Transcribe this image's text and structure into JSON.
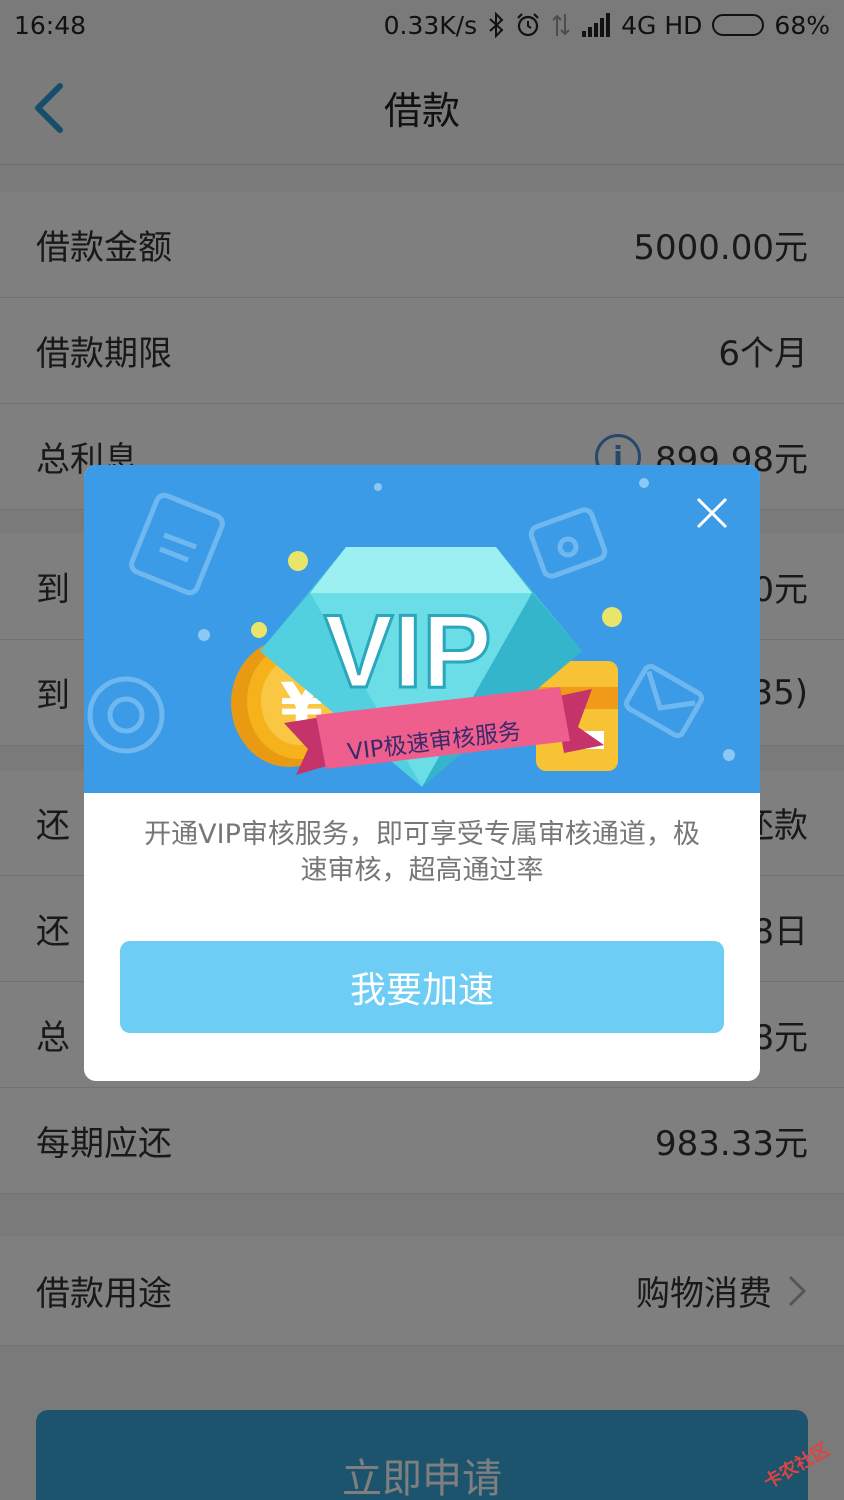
{
  "status_bar": {
    "time": "16:48",
    "network_speed": "0.33K/s",
    "network_type": "4G HD",
    "battery": "68%",
    "battery_level": 0.68,
    "icons": [
      "bluetooth-icon",
      "alarm-icon",
      "data-transfer-icon",
      "signal-icon",
      "battery-icon"
    ]
  },
  "header": {
    "title": "借款",
    "back_icon": "chevron-left-icon"
  },
  "loan": {
    "rows": [
      {
        "label": "借款金额",
        "value": "5000.00元"
      },
      {
        "label": "借款期限",
        "value": "6个月"
      },
      {
        "label": "总利息",
        "value": "899.98元"
      },
      {
        "label": "到",
        "value": "0元"
      },
      {
        "label": "到",
        "value": "35)"
      },
      {
        "label": "还",
        "value": "还款"
      },
      {
        "label": "还",
        "value": "8日"
      },
      {
        "label": "总",
        "value": "8元"
      },
      {
        "label": "每期应还",
        "value": "983.33元"
      }
    ],
    "purpose": {
      "label": "借款用途",
      "value": "购物消费"
    },
    "apply_label": "立即申请"
  },
  "modal": {
    "banner": {
      "vip_text": "VIP",
      "ribbon_text": "VIP极速审核服务",
      "yuan_symbol": "¥",
      "colors": {
        "background": "#3b9be6",
        "diamond": "#7fe3ea",
        "ribbon": "#ee5f8e",
        "coin": "#f6b21a",
        "card": "#f7c233"
      }
    },
    "description": "开通VIP审核服务，即可享受专属审核通道，极速审核，超高通过率",
    "button_label": "我要加速",
    "close_icon": "close-icon"
  },
  "watermark": "卡农社区"
}
